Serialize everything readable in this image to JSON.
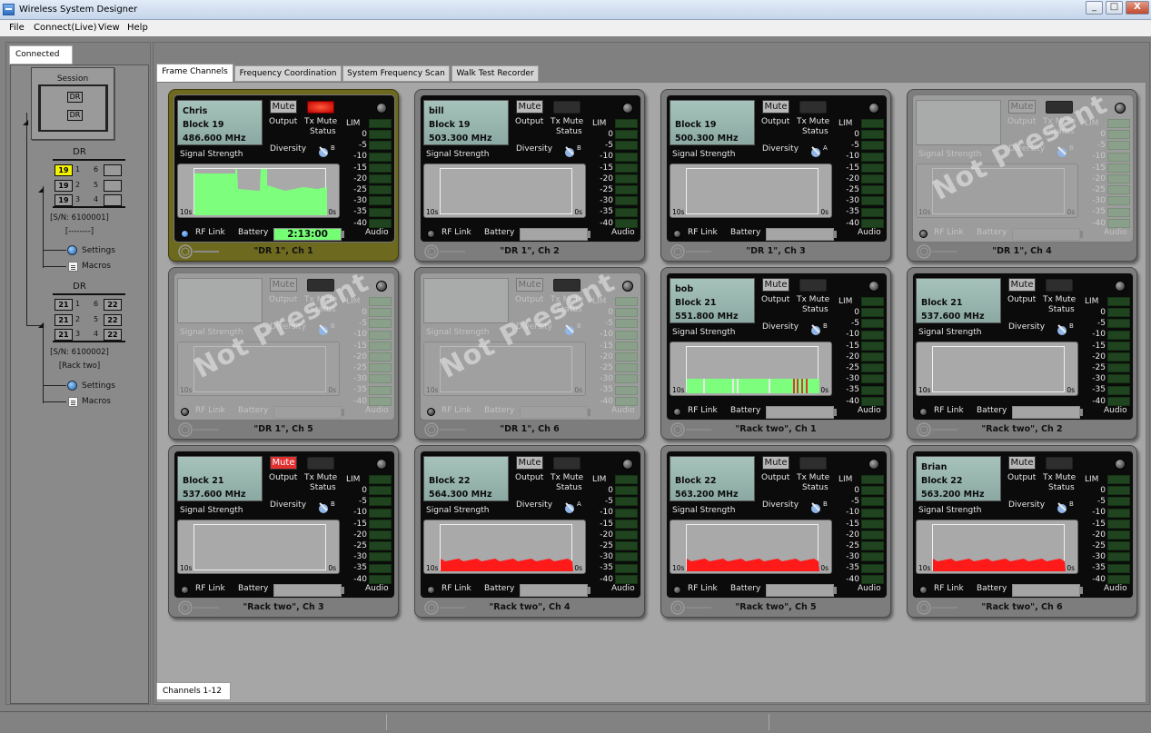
{
  "window": {
    "title": "Wireless System Designer",
    "min": "_",
    "max": "□",
    "close": "X"
  },
  "menu": [
    "File",
    "Connect(Live)",
    "View",
    "Help"
  ],
  "left_panel": {
    "tab": "Connected",
    "session": {
      "label": "Session",
      "slots": [
        "DR",
        "DR"
      ]
    },
    "devices": [
      {
        "title": "DR",
        "left": [
          "19",
          "19",
          "19"
        ],
        "right": [
          "",
          "",
          ""
        ],
        "serial": "[S/N: 6100001]",
        "name": "[--------]",
        "settings": "Settings",
        "macros": "Macros"
      },
      {
        "title": "DR",
        "left": [
          "21",
          "21",
          "21"
        ],
        "right": [
          "22",
          "22",
          "22"
        ],
        "serial": "[S/N: 6100002]",
        "name": "[Rack two]",
        "settings": "Settings",
        "macros": "Macros"
      }
    ]
  },
  "tabs": [
    "Frame Channels",
    "Frequency Coordination",
    "System Frequency Scan",
    "Walk Test Recorder"
  ],
  "bottom_tab": "Channels 1-12",
  "labels": {
    "mute": "Mute",
    "output": "Output",
    "tx1": "Tx Mute",
    "tx2": "Status",
    "lim": "LIM",
    "diversity": "Diversity",
    "signal": "Signal Strength",
    "rf": "RF Link",
    "battery": "Battery",
    "audio": "Audio",
    "t_left": "10s",
    "t_right": "0s",
    "watermark": "Not Present"
  },
  "scale": [
    "0",
    "-5",
    "-10",
    "-15",
    "-20",
    "-25",
    "-30",
    "-35",
    "-40"
  ],
  "channels": [
    {
      "name": "\"DR 1\", Ch 1",
      "line1": "Chris",
      "line2": "Block 19",
      "line3": "486.600 MHz",
      "battery": "2:13:00",
      "mute_red": false,
      "tx_red": true,
      "diversity": "B",
      "signal": "green_spiky",
      "rf": "blue",
      "present": true,
      "selected": true
    },
    {
      "name": "\"DR 1\", Ch 2",
      "line1": "bill",
      "line2": "Block 19",
      "line3": "503.300 MHz",
      "battery": "",
      "mute_red": false,
      "tx_red": false,
      "diversity": "B",
      "signal": "none",
      "rf": "off",
      "present": true,
      "selected": false
    },
    {
      "name": "\"DR 1\", Ch 3",
      "line1": "",
      "line2": "Block 19",
      "line3": "500.300 MHz",
      "battery": "",
      "mute_red": false,
      "tx_red": false,
      "diversity": "A",
      "signal": "none",
      "rf": "off",
      "present": true,
      "selected": false
    },
    {
      "name": "\"DR 1\", Ch 4",
      "line1": "",
      "line2": "",
      "line3": "",
      "battery": "",
      "mute_red": false,
      "tx_red": false,
      "diversity": "B",
      "signal": "none",
      "rf": "off",
      "present": false,
      "selected": false
    },
    {
      "name": "\"DR 1\", Ch 5",
      "line1": "",
      "line2": "",
      "line3": "",
      "battery": "",
      "mute_red": false,
      "tx_red": false,
      "diversity": "B",
      "signal": "none",
      "rf": "off",
      "present": false,
      "selected": false
    },
    {
      "name": "\"DR 1\", Ch 6",
      "line1": "",
      "line2": "",
      "line3": "",
      "battery": "",
      "mute_red": false,
      "tx_red": false,
      "diversity": "B",
      "signal": "none",
      "rf": "off",
      "present": false,
      "selected": false
    },
    {
      "name": "\"Rack two\", Ch 1",
      "line1": "bob",
      "line2": "Block 21",
      "line3": "551.800 MHz",
      "battery": "",
      "mute_red": false,
      "tx_red": false,
      "diversity": "B",
      "signal": "green_low",
      "rf": "off",
      "present": true,
      "selected": false
    },
    {
      "name": "\"Rack two\", Ch 2",
      "line1": "",
      "line2": "Block 21",
      "line3": "537.600 MHz",
      "battery": "",
      "mute_red": false,
      "tx_red": false,
      "diversity": "B",
      "signal": "none",
      "rf": "off",
      "present": true,
      "selected": false
    },
    {
      "name": "\"Rack two\", Ch 3",
      "line1": "",
      "line2": "Block 21",
      "line3": "537.600 MHz",
      "battery": "",
      "mute_red": true,
      "tx_red": false,
      "diversity": "B",
      "signal": "none",
      "rf": "off",
      "present": true,
      "selected": false
    },
    {
      "name": "\"Rack two\", Ch 4",
      "line1": "",
      "line2": "Block 22",
      "line3": "564.300 MHz",
      "battery": "",
      "mute_red": false,
      "tx_red": false,
      "diversity": "A",
      "signal": "red",
      "rf": "off",
      "present": true,
      "selected": false
    },
    {
      "name": "\"Rack two\", Ch 5",
      "line1": "",
      "line2": "Block 22",
      "line3": "563.200 MHz",
      "battery": "",
      "mute_red": false,
      "tx_red": false,
      "diversity": "B",
      "signal": "red",
      "rf": "off",
      "present": true,
      "selected": false
    },
    {
      "name": "\"Rack two\", Ch 6",
      "line1": "Brian",
      "line2": "Block 22",
      "line3": "563.200 MHz",
      "battery": "",
      "mute_red": false,
      "tx_red": false,
      "diversity": "B",
      "signal": "red",
      "rf": "off",
      "present": true,
      "selected": false
    }
  ],
  "colors": {
    "signal_green": "#7dff7d",
    "signal_red": "#ff1a1a",
    "tx_red": "#e01010",
    "mute_red": "#e03030",
    "battery_green": "#74ff74",
    "selected_card": "#6d6a1f",
    "meter_green": "#214420",
    "lcd": "#a6c2bb"
  }
}
